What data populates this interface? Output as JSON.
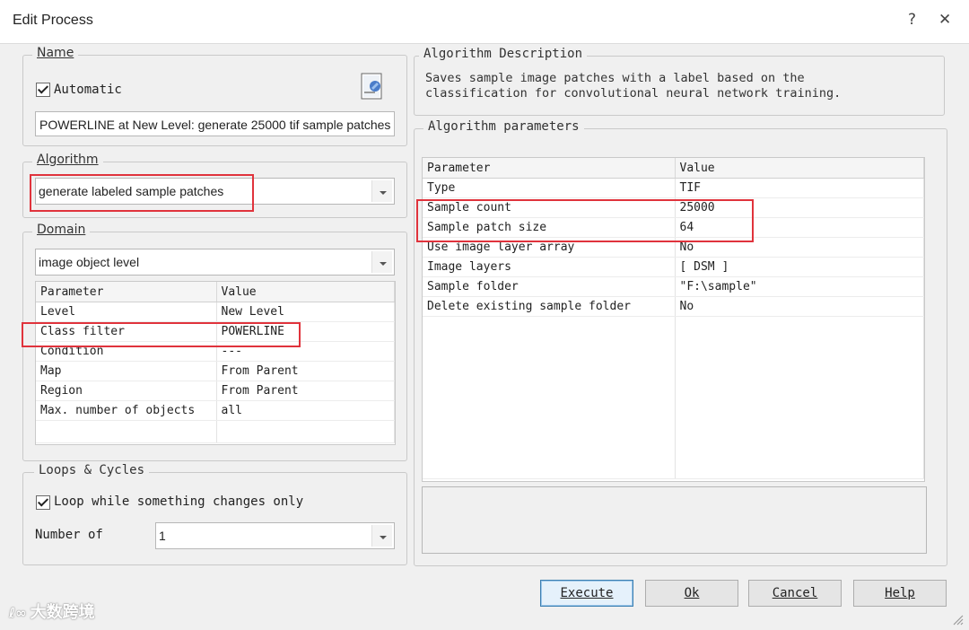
{
  "window": {
    "title": "Edit Process",
    "help_glyph": "?",
    "close_glyph": "✕"
  },
  "name_group": {
    "legend": "Name",
    "automatic_label": "Automatic",
    "automatic_checked": true,
    "name_value": "POWERLINE at  New Level: generate 25000 tif sample patches",
    "edit_icon": "edit-document-icon"
  },
  "algorithm_group": {
    "legend": "Algorithm",
    "selected": "generate labeled sample patches"
  },
  "domain_group": {
    "legend": "Domain",
    "selected": "image object level",
    "columns": [
      "Parameter",
      "Value"
    ],
    "rows": [
      [
        "Level",
        "New Level"
      ],
      [
        "Class filter",
        "POWERLINE"
      ],
      [
        "Condition",
        "---"
      ],
      [
        "Map",
        "From Parent"
      ],
      [
        "Region",
        "From Parent"
      ],
      [
        "Max. number of objects",
        "all"
      ]
    ]
  },
  "loops_group": {
    "legend": "Loops & Cycles",
    "loop_label": "Loop while something changes only",
    "loop_checked": true,
    "number_of_label": "Number of",
    "number_of_value": "1"
  },
  "description_group": {
    "legend": "Algorithm Description",
    "line1": "Saves sample image patches with a label based on the",
    "line2": "classification for convolutional neural network training."
  },
  "parameters_group": {
    "legend": "Algorithm parameters",
    "columns": [
      "Parameter",
      "Value"
    ],
    "rows": [
      [
        "Type",
        "TIF"
      ],
      [
        "Sample count",
        "25000"
      ],
      [
        "Sample patch size",
        "64"
      ],
      [
        "Use image layer array",
        "No"
      ],
      [
        "Image layers",
        "[ DSM ]"
      ],
      [
        "Sample folder",
        "\"F:\\sample\""
      ],
      [
        "Delete existing sample folder",
        "No"
      ]
    ]
  },
  "buttons": {
    "execute": "Execute",
    "ok": "Ok",
    "cancel": "Cancel",
    "help": "Help"
  },
  "watermark": "大数跨境",
  "colors": {
    "highlight_red": "#e0333c",
    "primary_button_border": "#3c7fb1"
  }
}
